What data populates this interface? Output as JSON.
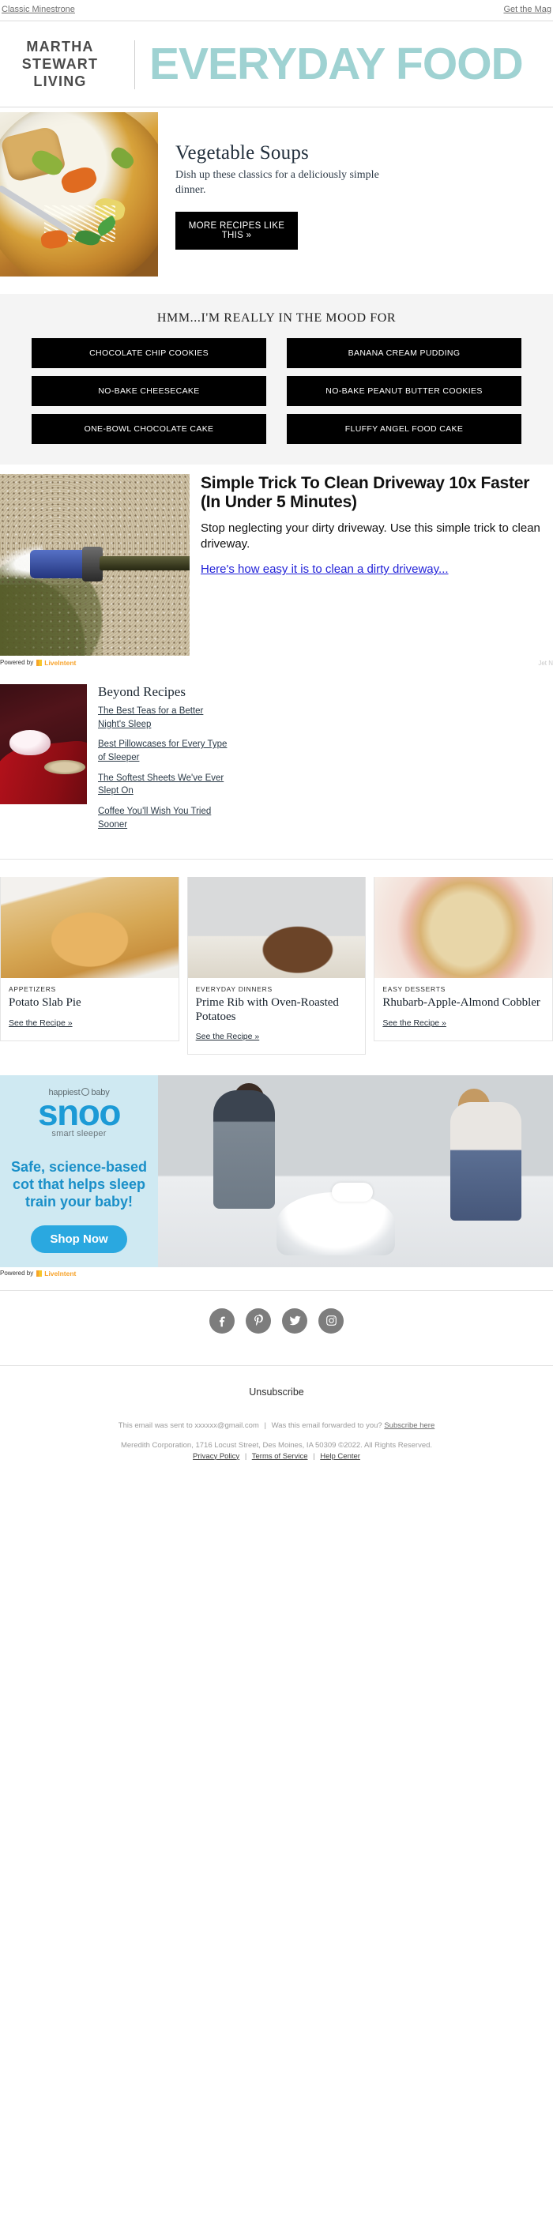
{
  "preheader": {
    "left_text": "Classic Minestrone",
    "right_text": "Get the Mag"
  },
  "masthead": {
    "brand_line1": "MARTHA",
    "brand_line2": "STEWART",
    "brand_line3": "LIVING",
    "publication": "EVERYDAY FOOD",
    "accent_color": "#9fd2d2"
  },
  "hero": {
    "image_alt": "vegetable-minestrone-soup-bowl",
    "title": "Vegetable Soups",
    "subtitle_line1": "Dish up these classics for a deliciously simple",
    "subtitle_line2": "dinner.",
    "cta_label": "MORE RECIPES LIKE THIS »"
  },
  "mood": {
    "heading": "HMM...I'M REALLY IN THE MOOD FOR",
    "buttons": [
      "CHOCOLATE CHIP COOKIES",
      "BANANA CREAM PUDDING",
      "NO-BAKE CHEESECAKE",
      "NO-BAKE PEANUT BUTTER COOKIES",
      "ONE-BOWL CHOCOLATE CAKE",
      "FLUFFY ANGEL FOOD CAKE"
    ]
  },
  "driveway_ad": {
    "image_alt": "pressure-washer-nozzle-spraying-driveway",
    "headline": "Simple Trick To Clean Driveway 10x Faster (In Under 5 Minutes)",
    "body": "Stop neglecting your dirty driveway. Use this simple trick to clean driveway.",
    "link_text": "Here's how easy it is to clean a dirty driveway...",
    "powered_by_prefix": "Powered by",
    "powered_by_brand": "LiveIntent",
    "sponsor": "Jet N"
  },
  "beyond": {
    "image_alt": "teacup-on-red-cloth",
    "title": "Beyond Recipes",
    "links": [
      "The Best Teas for a Better Night's Sleep",
      "Best Pillowcases for Every Type of Sleeper",
      "The Softest Sheets We've Ever Slept On",
      "Coffee You'll Wish You Tried Sooner"
    ]
  },
  "recipe_cards": [
    {
      "image_alt": "potato-slab-pie",
      "kicker": "APPETIZERS",
      "title": "Potato Slab Pie",
      "link": "See the Recipe »"
    },
    {
      "image_alt": "prime-rib-roast",
      "kicker": "EVERYDAY DINNERS",
      "title": "Prime Rib with Oven-Roasted Potatoes",
      "link": "See the Recipe »"
    },
    {
      "image_alt": "rhubarb-apple-almond-cobbler",
      "kicker": "EASY DESSERTS",
      "title": "Rhubarb-Apple-Almond Cobbler",
      "link": "See the Recipe »"
    }
  ],
  "snoo_ad": {
    "brand_left": "happiest",
    "brand_right": "baby",
    "product": "snoo",
    "tagline": "smart sleeper",
    "headline": "Safe, science-based cot that helps sleep train your baby!",
    "cta_label": "Shop Now",
    "image_alt": "parents-with-baby-in-snoo-bassinet",
    "powered_by_prefix": "Powered by",
    "powered_by_brand": "LiveIntent",
    "bg_color": "#cfe9f2",
    "accent_color": "#1c9ad6"
  },
  "footer": {
    "socials": [
      {
        "name": "facebook-icon",
        "label": "Facebook"
      },
      {
        "name": "pinterest-icon",
        "label": "Pinterest"
      },
      {
        "name": "twitter-icon",
        "label": "Twitter"
      },
      {
        "name": "instagram-icon",
        "label": "Instagram"
      }
    ],
    "unsubscribe": "Unsubscribe",
    "sent_to_text": "This email was sent to xxxxxx@gmail.com",
    "sent_separator": "|",
    "forwarded_text": "Was this email forwarded to you?",
    "subscribe_link": "Subscribe here",
    "address": "Meredith Corporation, 1716 Locust Street, Des Moines, IA 50309 ©2022. All Rights Reserved.",
    "legal_links": [
      "Privacy Policy",
      "Terms of Service",
      "Help Center"
    ],
    "legal_separator": "|"
  }
}
